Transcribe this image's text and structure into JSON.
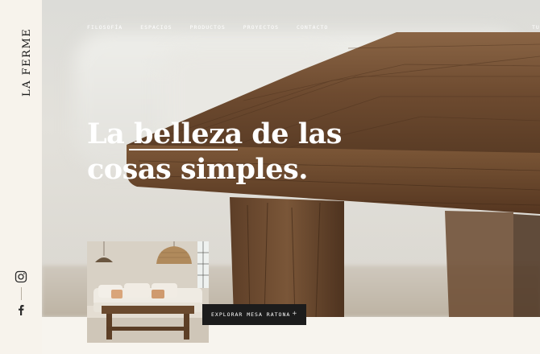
{
  "brand": {
    "name": "LA FERME"
  },
  "nav": {
    "items": [
      "FILOSOFÍA",
      "ESPACIOS",
      "PRODUCTOS",
      "PROYECTOS",
      "CONTACTO"
    ],
    "right_label": "TU"
  },
  "hero": {
    "headline_line1": "La belleza de las",
    "headline_line2": "cosas  simples."
  },
  "cta": {
    "label": "EXPLORAR MESA RATONA",
    "icon": "plus-icon"
  },
  "social": {
    "icons": [
      "instagram-icon",
      "facebook-icon"
    ]
  },
  "colors": {
    "sidebar_bg": "#f7f3ec",
    "cta_bg": "#1c1c1c",
    "wood": "#7a5436",
    "text_light": "#ffffff"
  }
}
